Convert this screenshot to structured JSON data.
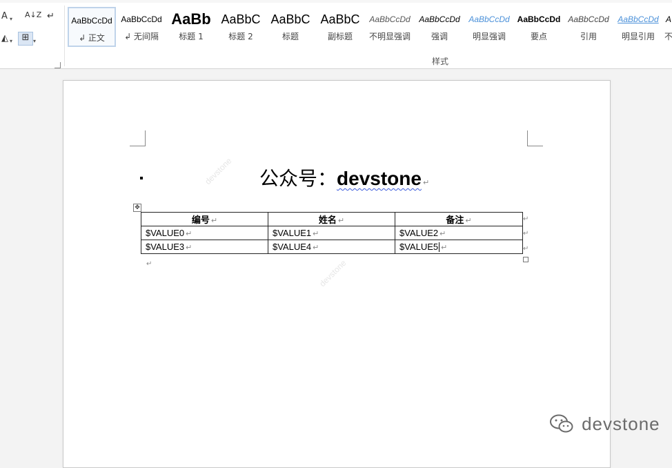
{
  "ribbon": {
    "left_tools": {
      "sort_label": "A↓Z",
      "pilcrow": "↵"
    },
    "styles": [
      {
        "preview": "AaBbCcDd",
        "name": "↲ 正文",
        "active": true
      },
      {
        "preview": "AaBbCcDd",
        "name": "↲ 无间隔"
      },
      {
        "preview": "AaBb",
        "name": "标题 1"
      },
      {
        "preview": "AaBbC",
        "name": "标题 2"
      },
      {
        "preview": "AaBbC",
        "name": "标题"
      },
      {
        "preview": "AaBbC",
        "name": "副标题"
      },
      {
        "preview": "AaBbCcDd",
        "name": "不明显强调"
      },
      {
        "preview": "AaBbCcDd",
        "name": "强调"
      },
      {
        "preview": "AaBbCcDd",
        "name": "明显强调"
      },
      {
        "preview": "AaBbCcDd",
        "name": "要点"
      },
      {
        "preview": "AaBbCcDd",
        "name": "引用"
      },
      {
        "preview": "AaBbCcDd",
        "name": "明显引用"
      },
      {
        "preview": "A",
        "name": "不"
      }
    ],
    "styles_group_label": "样式"
  },
  "document": {
    "title_cn": "公众号：",
    "title_en": "devstone",
    "paragraph_mark": "↵",
    "table": {
      "headers": [
        "编号",
        "姓名",
        "备注"
      ],
      "rows": [
        [
          "$VALUE0",
          "$VALUE1",
          "$VALUE2"
        ],
        [
          "$VALUE3",
          "$VALUE4",
          "$VALUE5"
        ]
      ]
    },
    "watermark": "devstone"
  },
  "brand": {
    "text": "devstone"
  },
  "colors": {
    "accent": "#3b5bdb",
    "emphasis_blue": "#4a90d9",
    "brand_gray": "#6b6b6b"
  }
}
